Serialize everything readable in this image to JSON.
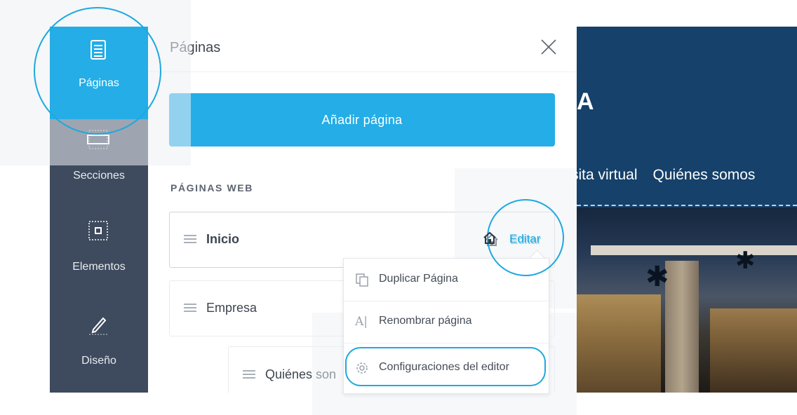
{
  "sidebar": {
    "items": [
      {
        "label": "Páginas",
        "icon": "pages-icon",
        "active": true
      },
      {
        "label": "Secciones",
        "icon": "sections-icon",
        "active": false
      },
      {
        "label": "Elementos",
        "icon": "elements-icon",
        "active": false
      },
      {
        "label": "Diseño",
        "icon": "design-pen-icon",
        "active": false
      }
    ]
  },
  "panel": {
    "title": "Páginas",
    "add_button": "Añadir página",
    "section_title": "PÁGINAS WEB",
    "pages": [
      {
        "name": "Inicio",
        "home": true,
        "action": "Editar"
      },
      {
        "name": "Empresa"
      },
      {
        "name": "Quiénes son"
      }
    ]
  },
  "menu": {
    "items": [
      {
        "label": "Duplicar Página",
        "icon": "duplicate-icon"
      },
      {
        "label": "Renombrar página",
        "icon": "rename-icon"
      },
      {
        "label": "Configuraciones del editor",
        "icon": "gear-icon"
      }
    ]
  },
  "preview": {
    "letter": "A",
    "nav": [
      "sita virtual",
      "Quiénes somos"
    ]
  },
  "colors": {
    "accent": "#24ade6",
    "sidebar": "#3e4a5d",
    "preview_bg": "#15416a"
  }
}
